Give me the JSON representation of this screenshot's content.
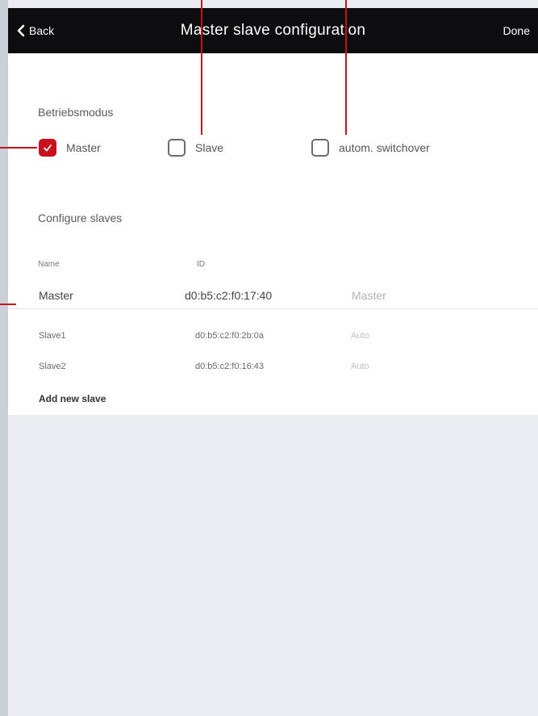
{
  "navbar": {
    "back_label": "Back",
    "title": "Master slave configuration",
    "done_label": "Done"
  },
  "mode_section": {
    "label": "Betriebsmodus",
    "options": [
      {
        "label": "Master",
        "checked": true
      },
      {
        "label": "Slave",
        "checked": false
      },
      {
        "label": "autom. switchover",
        "checked": false
      }
    ]
  },
  "slaves_section": {
    "label": "Configure slaves",
    "columns": {
      "name": "Name",
      "id": "ID"
    },
    "master_row": {
      "name": "Master",
      "id": "d0:b5:c2:f0:17:40",
      "role": "Master"
    },
    "slave_rows": [
      {
        "name": "Slave1",
        "id": "d0:b5:c2:f0:2b:0a",
        "role": "Auto"
      },
      {
        "name": "Slave2",
        "id": "d0:b5:c2:f0:16:43",
        "role": "Auto"
      }
    ],
    "add_label": "Add new slave"
  },
  "colors": {
    "accent": "#c8101e",
    "navbar_bg": "#0d0d0f",
    "page_bg": "#ecedf2",
    "frame_bg": "#c9d0d7"
  }
}
